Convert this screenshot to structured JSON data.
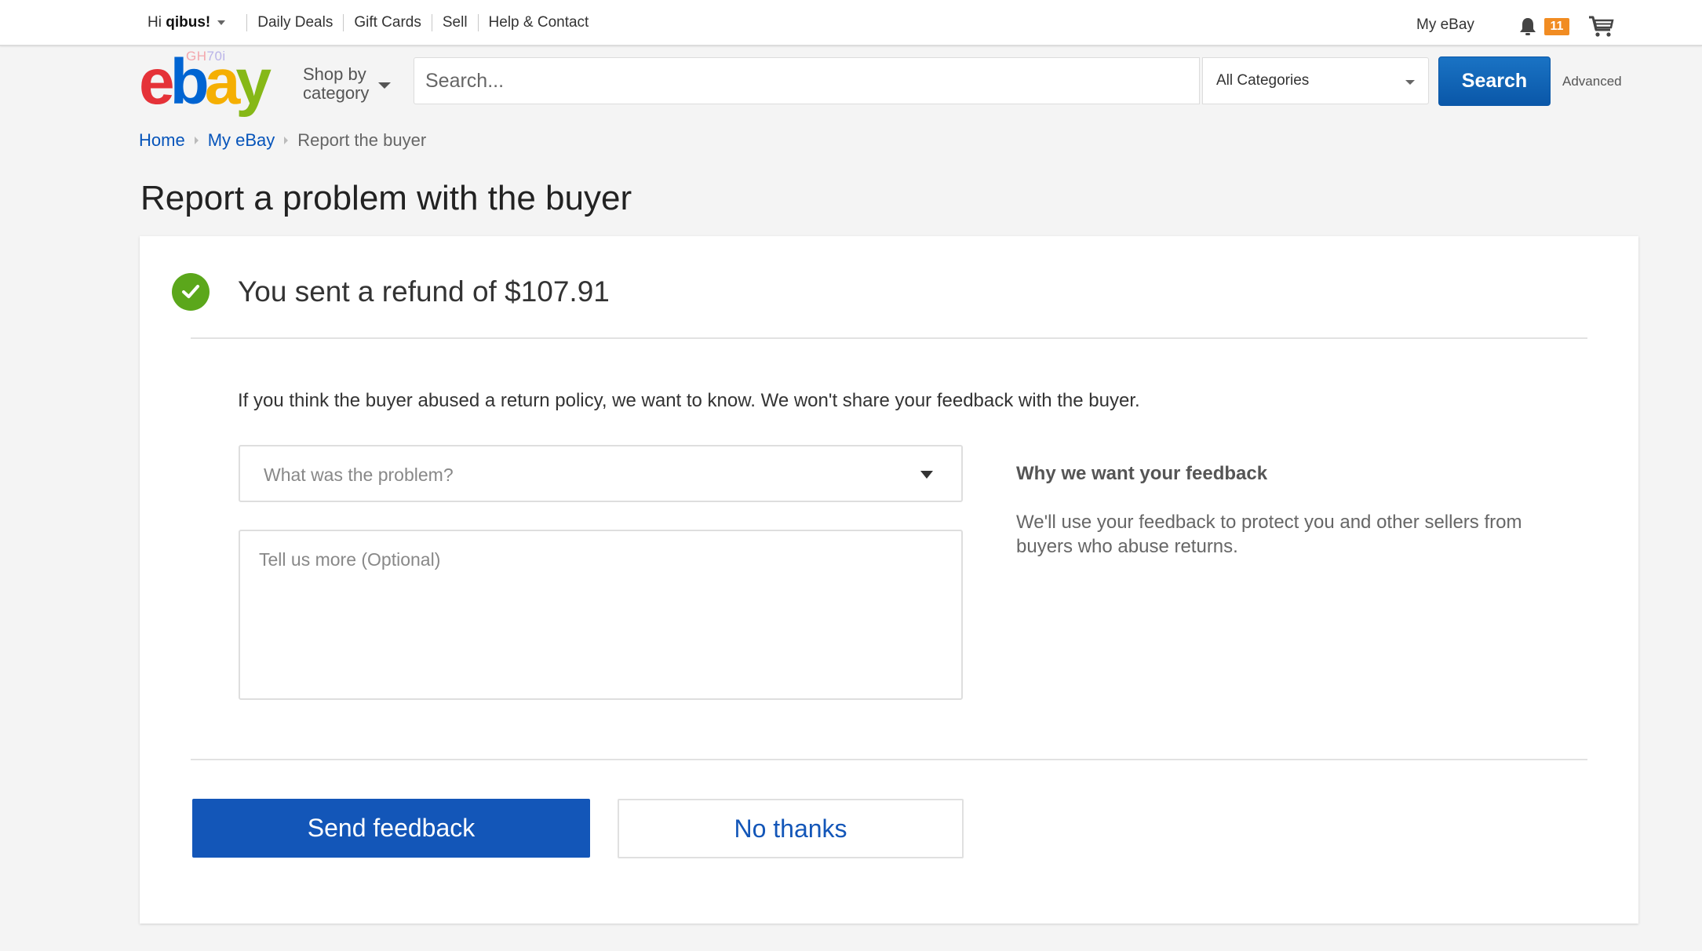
{
  "topbar": {
    "greeting_prefix": "Hi",
    "username": "qibus!",
    "links": [
      "Daily Deals",
      "Gift Cards",
      "Sell",
      "Help & Contact"
    ],
    "my_ebay": "My eBay",
    "notification_count": "11",
    "badge_color": "#f18c22"
  },
  "header": {
    "logo": {
      "e": "e",
      "b": "b",
      "a": "a",
      "y": "y",
      "doodle_a": "GH",
      "doodle_b": "70i"
    },
    "shop_by_line1": "Shop by",
    "shop_by_line2": "category",
    "search_placeholder": "Search...",
    "category_selected": "All Categories",
    "search_button": "Search",
    "advanced_link": "Advanced"
  },
  "breadcrumb": {
    "items": [
      {
        "label": "Home"
      },
      {
        "label": "My eBay"
      }
    ],
    "current": "Report the buyer"
  },
  "page": {
    "title": "Report a problem with the buyer"
  },
  "card": {
    "status_text": "You sent a refund of $107.91",
    "refund_amount": "$107.91",
    "intro": "If you think the buyer abused a return policy, we want to know. We won't share your feedback with the buyer.",
    "problem_select_placeholder": "What was the problem?",
    "details_placeholder": "Tell us more (Optional)",
    "aside_heading": "Why we want your feedback",
    "aside_text": "We'll use your feedback to protect you and other sellers from buyers who abuse returns.",
    "send_button": "Send feedback",
    "no_thanks_button": "No thanks",
    "primary_color": "#1356b8",
    "success_color": "#5ba71b"
  }
}
